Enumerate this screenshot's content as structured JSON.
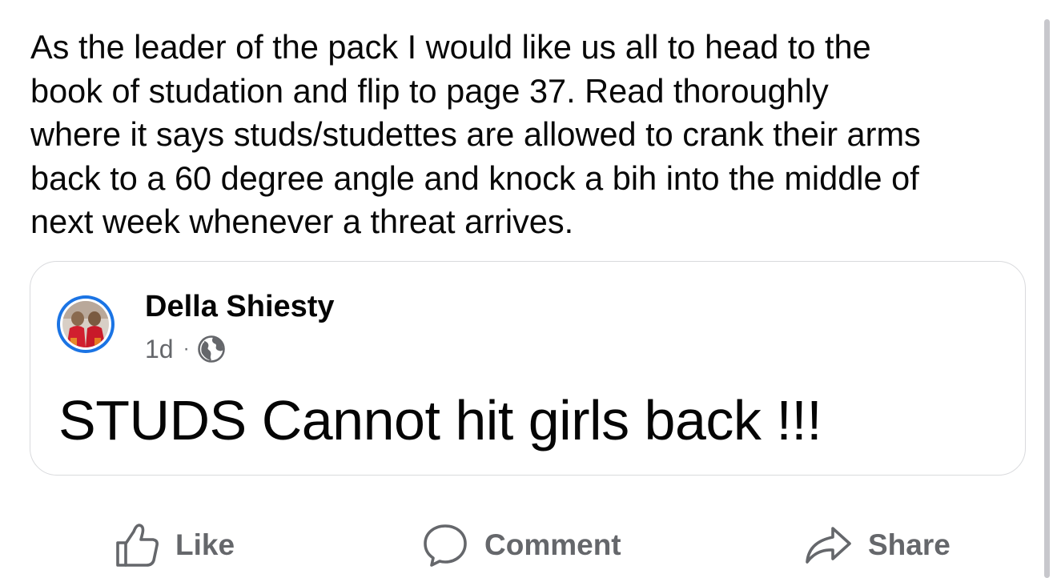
{
  "post": {
    "text": "As the leader of the pack I would like us all to head to the\nbook of studation and flip to page 37. Read thoroughly\nwhere it says studs/studettes are allowed to crank their arms\nback to a 60 degree angle and knock a bih into the middle of\nnext week whenever a threat arrives."
  },
  "shared_post": {
    "author": "Della Shiesty",
    "time": "1d",
    "separator": "·",
    "audience_icon": "globe-icon",
    "text": "STUDS Cannot hit girls back !!!"
  },
  "actions": {
    "like": {
      "label": "Like",
      "icon": "thumbs-up-icon"
    },
    "comment": {
      "label": "Comment",
      "icon": "comment-bubble-icon"
    },
    "share": {
      "label": "Share",
      "icon": "share-arrow-icon"
    }
  },
  "colors": {
    "text_primary": "#050505",
    "text_secondary": "#65676b",
    "avatar_ring": "#1b74e4",
    "card_border": "#d9dadd"
  }
}
